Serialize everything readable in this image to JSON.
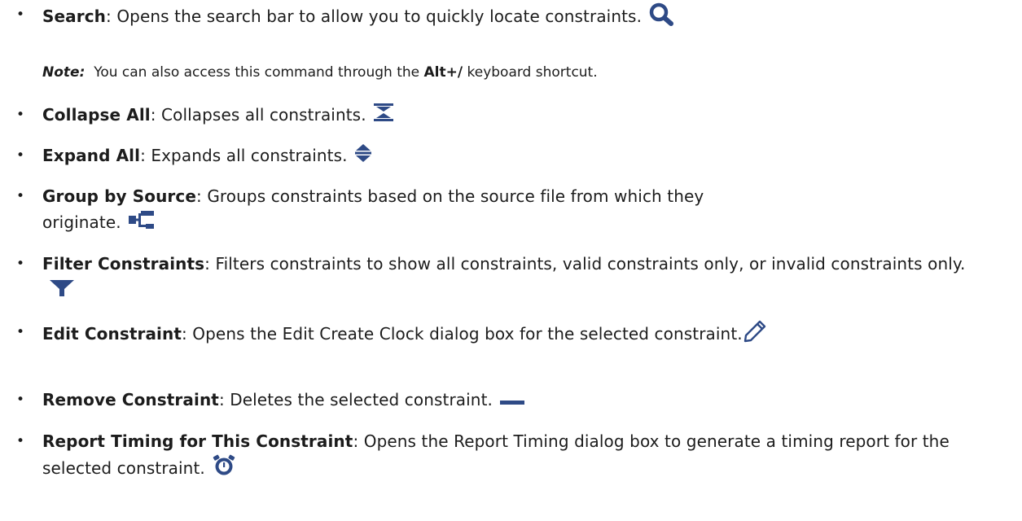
{
  "items": [
    {
      "term": "Search",
      "desc": ": Opens the search bar to allow you to quickly locate constraints.",
      "icon": "magnifier-icon"
    },
    {
      "term": "Collapse All",
      "desc": ": Collapses all constraints.",
      "icon": "collapse-all-icon"
    },
    {
      "term": "Expand All",
      "desc": ": Expands all constraints.",
      "icon": "expand-all-icon"
    },
    {
      "term": "Group by Source",
      "desc": ": Groups constraints based on the source file from which they originate.",
      "icon": "tree-hierarchy-icon"
    },
    {
      "term": "Filter Constraints",
      "desc": ": Filters constraints to show all constraints, valid constraints only, or invalid constraints only.",
      "icon": "funnel-icon"
    },
    {
      "term": "Edit Constraint",
      "desc": ": Opens the Edit Create Clock dialog box for the selected constraint.",
      "icon": "pencil-icon"
    },
    {
      "term": "Remove Constraint",
      "desc": ": Deletes the selected constraint.",
      "icon": "minus-icon"
    },
    {
      "term": "Report Timing for This Constraint",
      "desc": ": Opens the Report Timing dialog box to generate a timing report for the selected constraint.",
      "icon": "stopwatch-icon"
    }
  ],
  "note": {
    "label": "Note:",
    "before": "You can also access this command through the",
    "shortcut": "Alt+/",
    "after": "keyboard shortcut."
  },
  "bullet_char": "•",
  "icon_color": "#2e4a86"
}
